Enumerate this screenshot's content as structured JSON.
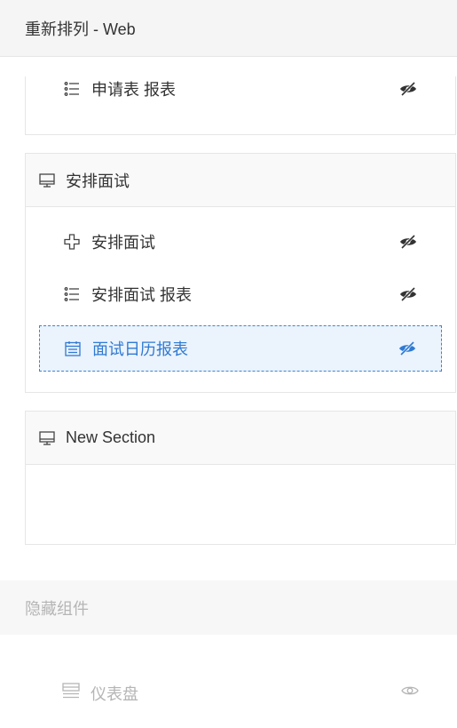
{
  "header": {
    "title": "重新排列 - Web"
  },
  "section_partial": {
    "items": [
      {
        "label": "申请表 报表",
        "icon": "list-icon",
        "visible": false
      }
    ]
  },
  "section_interview": {
    "title": "安排面试",
    "icon": "monitor-icon",
    "items": [
      {
        "label": "安排面试",
        "icon": "plus-outline-icon",
        "visible": false
      },
      {
        "label": "安排面试 报表",
        "icon": "list-icon",
        "visible": false
      },
      {
        "label": "面试日历报表",
        "icon": "calendar-icon",
        "visible": false,
        "selected": true
      }
    ]
  },
  "section_new": {
    "title": "New Section",
    "icon": "monitor-icon"
  },
  "hidden": {
    "title": "隐藏组件",
    "items": [
      {
        "label": "仪表盘",
        "icon": "dashboard-icon",
        "visible": true
      }
    ]
  },
  "colors": {
    "accent": "#2f7ad3",
    "muted": "#b5b5b5",
    "text": "#333333"
  }
}
